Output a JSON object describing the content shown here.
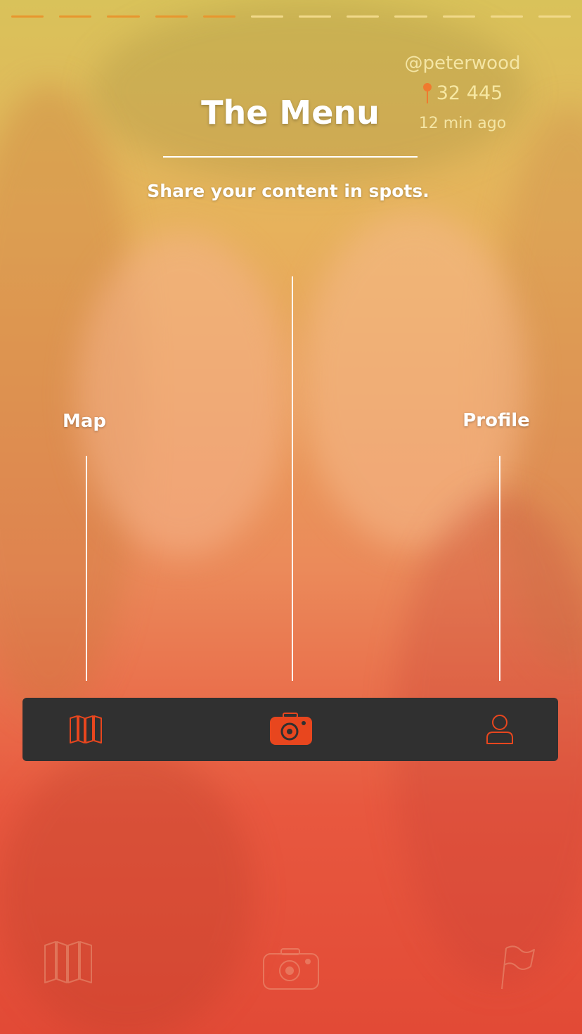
{
  "colors": {
    "accent": "#e8461e",
    "tabbar_bg": "#303030",
    "progress_done": "#e8962e",
    "progress_todo": "#f1d98a"
  },
  "progress": {
    "segments_total": 12,
    "segments_done": 5
  },
  "post": {
    "username": "@peterwood",
    "spot_count": "32 445",
    "time_ago": "12 min ago"
  },
  "menu": {
    "title": "The Menu",
    "subtitle": "Share your content in spots.",
    "left_label": "Map",
    "right_label": "Profile"
  },
  "tabbar": {
    "items": [
      {
        "icon": "map-icon",
        "active": false
      },
      {
        "icon": "camera-icon",
        "active": true
      },
      {
        "icon": "user-icon",
        "active": false
      }
    ]
  },
  "bottom_ghost_icons": [
    "map-icon",
    "camera-icon",
    "flag-icon"
  ]
}
